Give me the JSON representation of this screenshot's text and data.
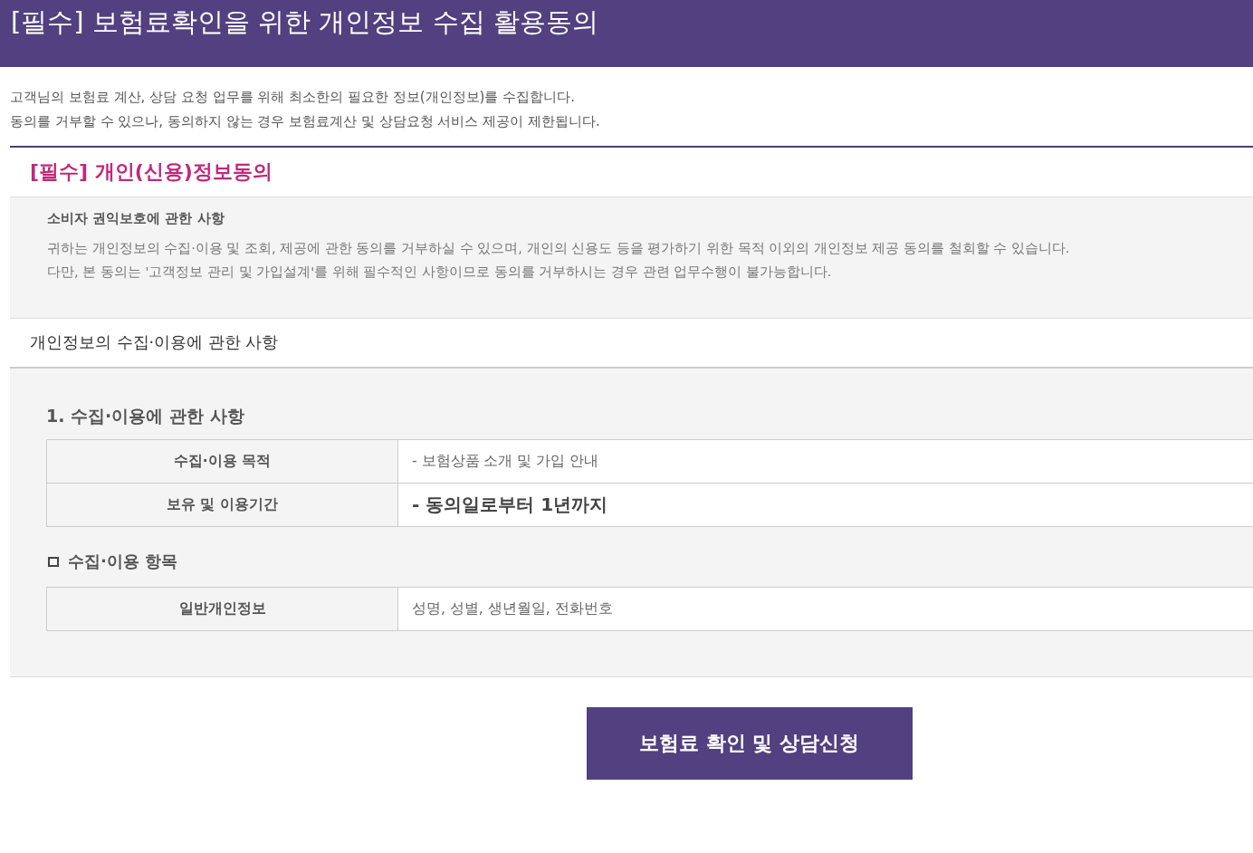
{
  "header": {
    "title": "[필수] 보험료확인을 위한 개인정보 수집 활용동의"
  },
  "intro": [
    "고객님의 보험료 계산, 상담 요청 업무를 위해 최소한의 필요한 정보(개인정보)를 수집합니다.",
    "동의를 거부할 수 있으나, 동의하지 않는 경우 보험료계산 및 상담요청 서비스 제공이 제한됩니다."
  ],
  "section_title": "[필수] 개인(신용)정보동의",
  "notice": {
    "title": "소비자 권익보호에 관한 사항",
    "lines": [
      "귀하는 개인정보의 수집·이용 및 조회, 제공에 관한 동의를 거부하실 수 있으며, 개인의 신용도 등을 평가하기 위한 목적 이외의 개인정보 제공 동의를 철회할 수 있습니다.",
      "다만, 본 동의는 '고객정보 관리 및 가입설계'를 위해 필수적인 사항이므로 동의를 거부하시는 경우 관련 업무수행이 불가능합니다."
    ]
  },
  "subsection_title": "개인정보의 수집·이용에 관한 사항",
  "detail": {
    "heading": "1. 수집·이용에 관한 사항",
    "table": [
      {
        "label": "수집·이용 목적",
        "value": "- 보험상품 소개 및 가입 안내",
        "emphasized": false
      },
      {
        "label": "보유 및 이용기간",
        "value": "- 동의일로부터 1년까지",
        "emphasized": true
      }
    ],
    "items_heading": "수집·이용 항목",
    "items_table": [
      {
        "label": "일반개인정보",
        "value": "성명, 성별, 생년월일, 전화번호",
        "emphasized": false
      }
    ]
  },
  "button": "보험료 확인 및 상담신청"
}
